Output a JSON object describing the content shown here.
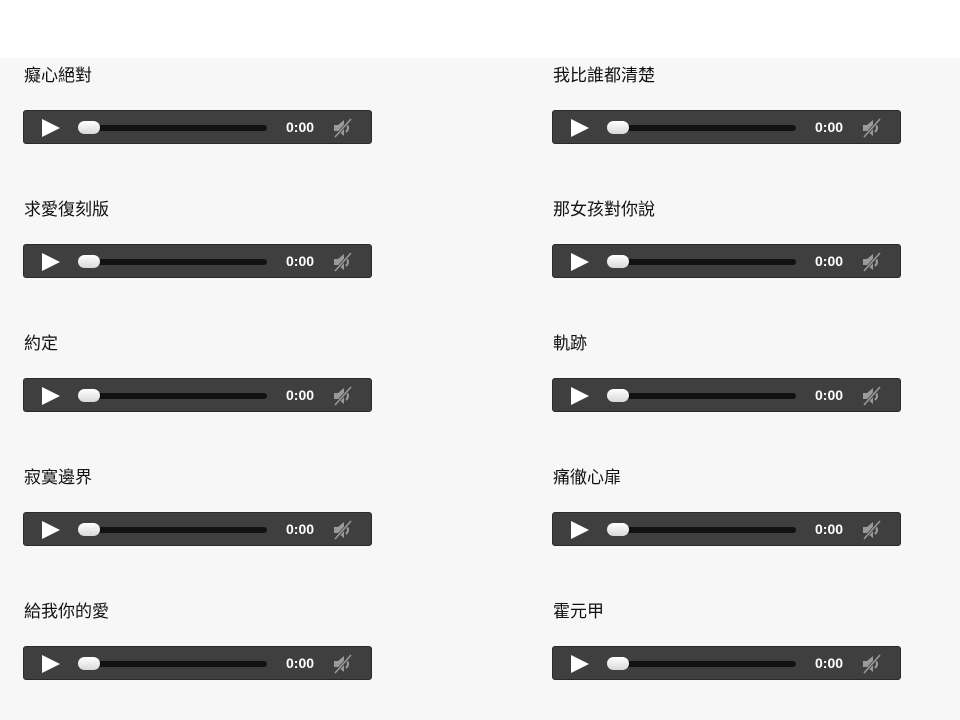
{
  "tracks": [
    {
      "title": "癡心絕對",
      "time": "0:00",
      "progress": 0
    },
    {
      "title": "我比誰都清楚",
      "time": "0:00",
      "progress": 0
    },
    {
      "title": "求愛復刻版",
      "time": "0:00",
      "progress": 0
    },
    {
      "title": "那女孩對你說",
      "time": "0:00",
      "progress": 0
    },
    {
      "title": "約定",
      "time": "0:00",
      "progress": 0
    },
    {
      "title": "軌跡",
      "time": "0:00",
      "progress": 0
    },
    {
      "title": "寂寞邊界",
      "time": "0:00",
      "progress": 0
    },
    {
      "title": "痛徹心扉",
      "time": "0:00",
      "progress": 0
    },
    {
      "title": "給我你的愛",
      "time": "0:00",
      "progress": 0
    },
    {
      "title": "霍元甲",
      "time": "0:00",
      "progress": 0
    }
  ],
  "icons": {
    "play": "play-icon",
    "volume": "volume-muted-icon"
  },
  "colors": {
    "player_bg": "#3f3f3f",
    "progress_track": "#111111",
    "knob": "#f0f0f0",
    "time_text": "#ffffff",
    "page_bg": "#f7f7f7"
  }
}
